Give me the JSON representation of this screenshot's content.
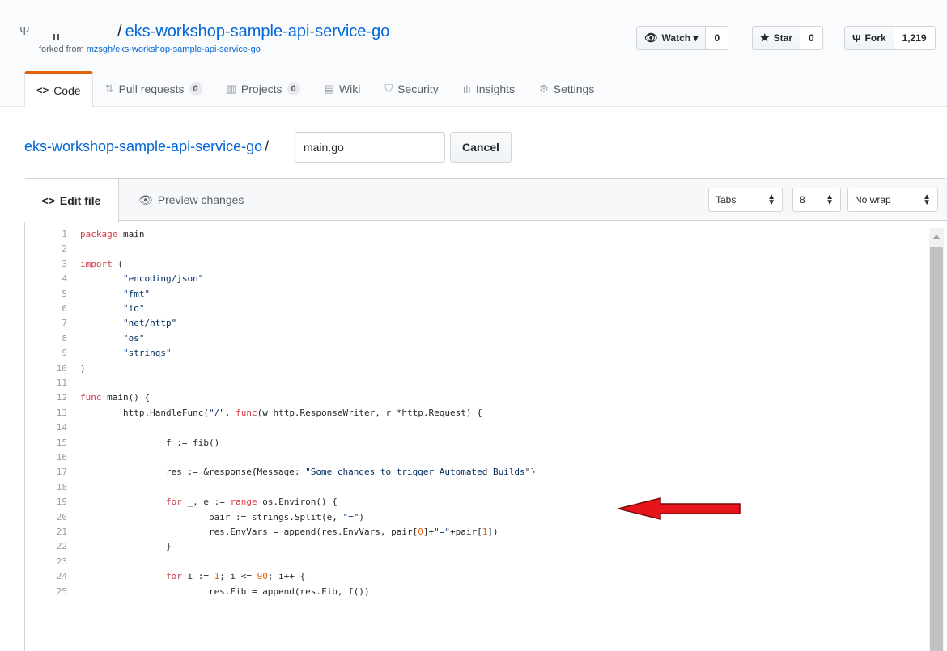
{
  "repo": {
    "fork_icon": "repo-forked-icon",
    "owner_separator": "/",
    "name": "eks-workshop-sample-api-service-go",
    "forked_from_label": "forked from",
    "forked_from_link": "mzsgh/eks-workshop-sample-api-service-go"
  },
  "actions": {
    "watch": {
      "icon": "eye-icon",
      "label": "Watch ▾",
      "count": "0"
    },
    "star": {
      "icon": "star-icon",
      "label": "Star",
      "count": "0"
    },
    "fork": {
      "icon": "repo-forked-icon",
      "label": "Fork",
      "count": "1,219"
    }
  },
  "nav": {
    "code": "Code",
    "pull_requests": "Pull requests",
    "pull_requests_count": "0",
    "projects": "Projects",
    "projects_count": "0",
    "wiki": "Wiki",
    "security": "Security",
    "insights": "Insights",
    "settings": "Settings"
  },
  "breadcrumb": {
    "repo": "eks-workshop-sample-api-service-go",
    "slash": "/",
    "filename": "main.go",
    "cancel": "Cancel"
  },
  "editor": {
    "edit_tab": "Edit file",
    "preview_tab": "Preview changes",
    "indent_mode": "Tabs",
    "indent_size": "8",
    "wrap_mode": "No wrap"
  },
  "annotation": {
    "color": "#e8141b",
    "description": "red arrow pointing to line 17"
  },
  "code_lines": [
    "package main",
    "",
    "import (",
    "        \"encoding/json\"",
    "        \"fmt\"",
    "        \"io\"",
    "        \"net/http\"",
    "        \"os\"",
    "        \"strings\"",
    ")",
    "",
    "func main() {",
    "        http.HandleFunc(\"/\", func(w http.ResponseWriter, r *http.Request) {",
    "",
    "                f := fib()",
    "",
    "                res := &response{Message: \"Some changes to trigger Automated Builds\"}",
    "",
    "                for _, e := range os.Environ() {",
    "                        pair := strings.Split(e, \"=\")",
    "                        res.EnvVars = append(res.EnvVars, pair[0]+\"=\"+pair[1])",
    "                }",
    "",
    "                for i := 1; i <= 90; i++ {",
    "                        res.Fib = append(res.Fib, f())"
  ]
}
